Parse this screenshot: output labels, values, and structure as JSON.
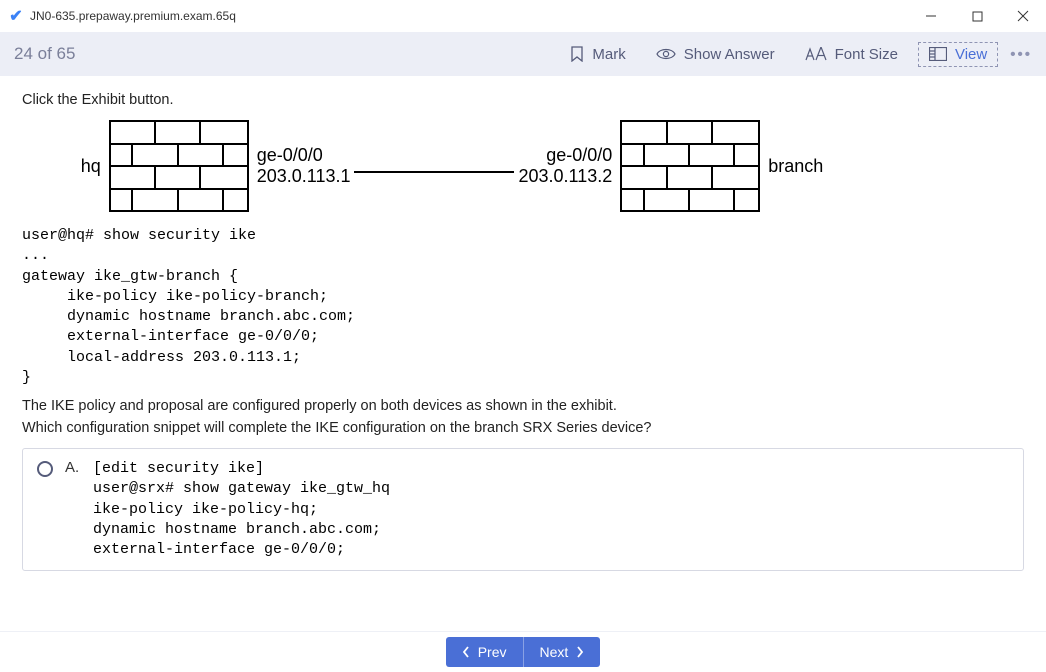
{
  "window": {
    "title": "JN0-635.prepaway.premium.exam.65q",
    "appicon": "✔"
  },
  "toolbar": {
    "counter": "24 of 65",
    "mark": "Mark",
    "show_answer": "Show Answer",
    "font_size": "Font Size",
    "view": "View",
    "more": "•••"
  },
  "question": {
    "instruction": "Click the Exhibit button.",
    "diagram": {
      "left_label": "hq",
      "right_label": "branch",
      "left_if": "ge-0/0/0",
      "left_ip": "203.0.113.1",
      "right_if": "ge-0/0/0",
      "right_ip": "203.0.113.2"
    },
    "config_snippet": "user@hq# show security ike\n...\ngateway ike_gtw-branch {\n     ike-policy ike-policy-branch;\n     dynamic hostname branch.abc.com;\n     external-interface ge-0/0/0;\n     local-address 203.0.113.1;\n}",
    "statement1": "The IKE policy and proposal are configured properly on both devices as shown in the exhibit.",
    "statement2": "Which configuration snippet will complete the IKE configuration on the branch SRX Series device?"
  },
  "options": {
    "a": {
      "letter": "A.",
      "body": "[edit security ike]\nuser@srx# show gateway ike_gtw_hq\nike-policy ike-policy-hq;\ndynamic hostname branch.abc.com;\nexternal-interface ge-0/0/0;"
    }
  },
  "nav": {
    "prev": "Prev",
    "next": "Next"
  }
}
